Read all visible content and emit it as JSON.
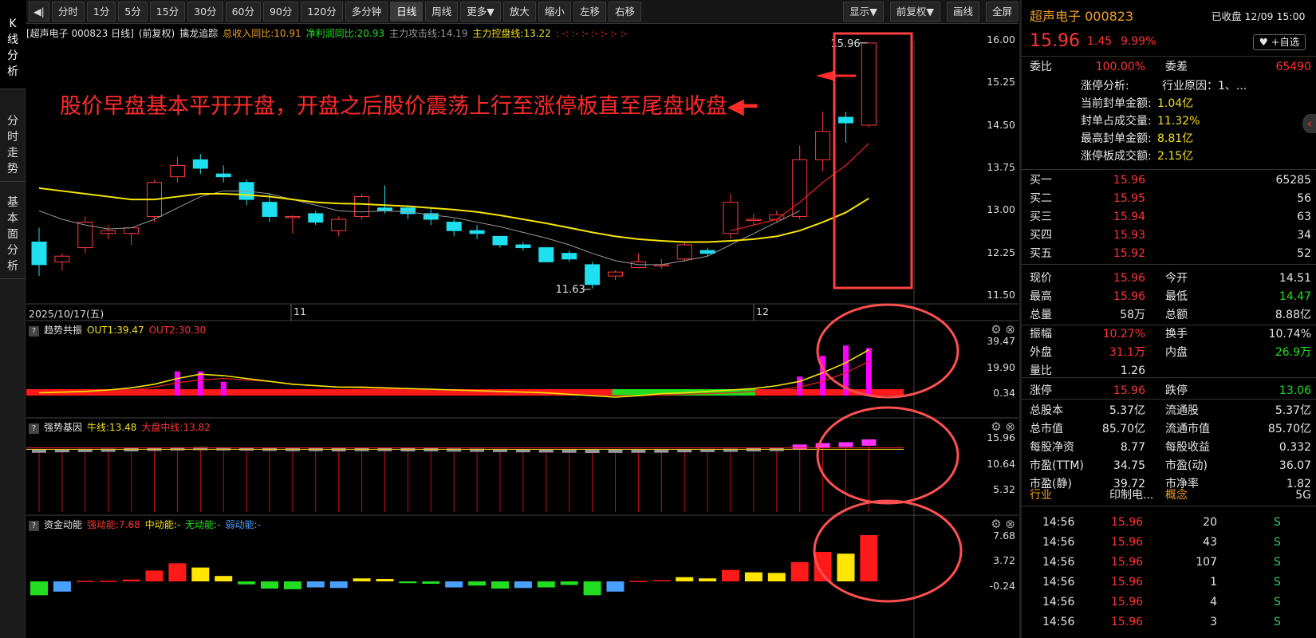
{
  "side_tabs": [
    "K线分析",
    "分时走势",
    "基本面分析"
  ],
  "toolbar": {
    "back_icon": "collapse-left-icon",
    "periods": [
      "分时",
      "1分",
      "5分",
      "15分",
      "30分",
      "60分",
      "90分",
      "120分",
      "多分钟",
      "日线",
      "周线",
      "更多▼"
    ],
    "active_period": "日线",
    "actions": [
      "放大",
      "缩小",
      "左移",
      "右移"
    ],
    "right_menus": [
      "显示▼",
      "前复权▼",
      "画线",
      "全屏"
    ]
  },
  "main_header": {
    "stock": "[超声电子 000823 日线]",
    "adjust": "(前复权)",
    "indicator": "擒龙追踪",
    "revenue": "总收入同比:10.91",
    "profit": "净利润同比:20.93",
    "attack": "主力攻击线:14.19",
    "control": "主力控盘线:13.22",
    "dots": ": -: :- :- :- :- :- :-"
  },
  "annotation": "股价早盘基本平开开盘，开盘之后股价震荡上行至涨停板直至尾盘收盘◀━",
  "price_axis": [
    "16.00",
    "15.25",
    "14.50",
    "13.75",
    "13.00",
    "12.25",
    "11.50"
  ],
  "price_labels": {
    "high": "15.96",
    "low": "11.63"
  },
  "date_axis": [
    "2025/10/17(五)",
    "11",
    "12"
  ],
  "pane1": {
    "name": "趋势共振",
    "out1": "OUT1:39.47",
    "out2": "OUT2:30.30",
    "axis": [
      "39.47",
      "19.90",
      "0.34"
    ]
  },
  "pane2": {
    "name": "强势基因",
    "niu": "牛线:13.48",
    "dapan": "大盘中线:13.82",
    "axis": [
      "15.96",
      "10.64",
      "5.32"
    ]
  },
  "pane3": {
    "name": "资金动能",
    "strong": "强动能:7.68",
    "mid": "中动能:-",
    "none": "无动能:-",
    "weak": "弱动能:-",
    "axis": [
      "7.68",
      "3.72",
      "-0.24"
    ]
  },
  "chart_data": {
    "type": "candlestick",
    "ylim": [
      11.5,
      16.0
    ],
    "candles": [
      [
        12.45,
        12.7,
        11.85,
        12.05
      ],
      [
        12.1,
        12.25,
        11.95,
        12.2
      ],
      [
        12.35,
        12.9,
        12.25,
        12.8
      ],
      [
        12.6,
        12.75,
        12.5,
        12.65
      ],
      [
        12.6,
        12.7,
        12.4,
        12.7
      ],
      [
        12.9,
        13.55,
        12.8,
        13.5
      ],
      [
        13.6,
        13.95,
        13.5,
        13.8
      ],
      [
        13.9,
        14.0,
        13.65,
        13.75
      ],
      [
        13.65,
        13.8,
        13.5,
        13.6
      ],
      [
        13.5,
        13.55,
        13.1,
        13.2
      ],
      [
        13.15,
        13.3,
        12.8,
        12.9
      ],
      [
        12.9,
        12.92,
        12.6,
        12.9
      ],
      [
        12.95,
        13.0,
        12.75,
        12.8
      ],
      [
        12.65,
        12.9,
        12.55,
        12.85
      ],
      [
        12.9,
        13.3,
        12.85,
        13.25
      ],
      [
        13.05,
        13.45,
        12.95,
        13.0
      ],
      [
        13.05,
        13.1,
        12.85,
        12.95
      ],
      [
        12.95,
        13.05,
        12.75,
        12.85
      ],
      [
        12.8,
        12.85,
        12.55,
        12.65
      ],
      [
        12.65,
        12.75,
        12.5,
        12.6
      ],
      [
        12.55,
        12.55,
        12.35,
        12.4
      ],
      [
        12.4,
        12.45,
        12.3,
        12.35
      ],
      [
        12.35,
        12.35,
        12.1,
        12.1
      ],
      [
        12.25,
        12.3,
        12.1,
        12.15
      ],
      [
        12.05,
        12.1,
        11.63,
        11.7
      ],
      [
        11.85,
        11.95,
        11.78,
        11.92
      ],
      [
        12.0,
        12.25,
        11.98,
        12.1
      ],
      [
        12.05,
        12.15,
        11.98,
        12.05
      ],
      [
        12.15,
        12.45,
        12.1,
        12.4
      ],
      [
        12.3,
        12.35,
        12.2,
        12.25
      ],
      [
        12.6,
        13.3,
        12.5,
        13.15
      ],
      [
        12.85,
        12.95,
        12.75,
        12.85
      ],
      [
        12.85,
        13.0,
        12.8,
        12.93
      ],
      [
        12.9,
        14.15,
        12.85,
        13.9
      ],
      [
        13.9,
        14.75,
        13.7,
        14.4
      ],
      [
        14.65,
        14.75,
        14.2,
        14.55
      ],
      [
        14.51,
        15.96,
        14.47,
        15.96
      ]
    ],
    "ma_yellow": [
      13.4,
      13.35,
      13.3,
      13.25,
      13.2,
      13.2,
      13.25,
      13.3,
      13.3,
      13.28,
      13.25,
      13.2,
      13.15,
      13.13,
      13.12,
      13.1,
      13.08,
      13.05,
      13.02,
      12.98,
      12.92,
      12.85,
      12.78,
      12.7,
      12.62,
      12.55,
      12.5,
      12.47,
      12.45,
      12.45,
      12.47,
      12.5,
      12.55,
      12.65,
      12.8,
      12.97,
      13.22
    ],
    "ma_gray": [
      13.0,
      12.85,
      12.75,
      12.68,
      12.7,
      12.85,
      13.05,
      13.25,
      13.35,
      13.35,
      13.3,
      13.2,
      13.1,
      13.0,
      12.98,
      13.0,
      12.98,
      12.93,
      12.88,
      12.8,
      12.72,
      12.62,
      12.52,
      12.4,
      12.25,
      12.12,
      12.05,
      12.05,
      12.12,
      12.2,
      12.4,
      12.6,
      12.8,
      13.0,
      null,
      null,
      null
    ],
    "ma_red": [
      null,
      null,
      null,
      null,
      null,
      null,
      null,
      null,
      null,
      null,
      null,
      null,
      null,
      null,
      null,
      null,
      null,
      null,
      null,
      null,
      null,
      null,
      null,
      null,
      null,
      null,
      null,
      null,
      null,
      null,
      12.65,
      12.75,
      12.85,
      13.15,
      13.5,
      13.8,
      14.19
    ],
    "pane1_bars": [
      0,
      0,
      0,
      0,
      0,
      0,
      0.5,
      0.5,
      0.3,
      0,
      0,
      0,
      0,
      0,
      0,
      0,
      0,
      0,
      0,
      0,
      0,
      0,
      0,
      0,
      0,
      0,
      0,
      0,
      0,
      0,
      0,
      0,
      0,
      0.4,
      0.8,
      1.0,
      0.95
    ],
    "pane1_strip_green": [
      25,
      31
    ],
    "pane2_levels": [
      13.0,
      13.1,
      13.15,
      13.2,
      13.3,
      13.4,
      13.5,
      13.55,
      13.5,
      13.45,
      13.4,
      13.35,
      13.35,
      13.3,
      13.35,
      13.35,
      13.3,
      13.3,
      13.25,
      13.2,
      13.15,
      13.1,
      13.05,
      13.0,
      12.95,
      12.98,
      13.0,
      13.02,
      13.1,
      13.15,
      13.2,
      13.3,
      13.35,
      14.1,
      14.4,
      14.6,
      15.2
    ],
    "pane3_values": [
      -2.3,
      -1.7,
      0.1,
      0.1,
      0.3,
      1.8,
      3.0,
      2.3,
      0.9,
      -0.5,
      -1.2,
      -1.3,
      -1.0,
      -1.1,
      0.5,
      0.4,
      -0.3,
      -0.4,
      -1.0,
      -0.7,
      -1.2,
      -1.1,
      -1.0,
      -0.6,
      -2.3,
      -1.7,
      0.1,
      0.2,
      0.7,
      0.5,
      1.9,
      1.5,
      1.4,
      3.2,
      4.9,
      4.6,
      7.68
    ]
  },
  "quote": {
    "name": "超声电子 000823",
    "status": "已收盘 12/09 15:00",
    "price": "15.96",
    "change": "1.45",
    "pct": "9.99%",
    "fav": "+自选",
    "weibi_label": "委比",
    "weibi": "100.00%",
    "weicha_label": "委差",
    "weicha": "65490",
    "limit_up": [
      {
        "k": "涨停分析:",
        "v": "行业原因：1、..."
      },
      {
        "k": "当前封单金额:",
        "v": "1.04亿"
      },
      {
        "k": "封单占成交量:",
        "v": "11.32%"
      },
      {
        "k": "最高封单金额:",
        "v": "8.81亿"
      },
      {
        "k": "涨停板成交额:",
        "v": "2.15亿"
      }
    ],
    "buys": [
      {
        "label": "买一",
        "price": "15.96",
        "vol": "65285"
      },
      {
        "label": "买二",
        "price": "15.95",
        "vol": "56"
      },
      {
        "label": "买三",
        "price": "15.94",
        "vol": "63"
      },
      {
        "label": "买四",
        "price": "15.93",
        "vol": "34"
      },
      {
        "label": "买五",
        "price": "15.92",
        "vol": "52"
      }
    ],
    "stats": [
      [
        {
          "k": "现价",
          "v": "15.96",
          "c": "red"
        },
        {
          "k": "今开",
          "v": "14.51",
          "c": "white"
        }
      ],
      [
        {
          "k": "最高",
          "v": "15.96",
          "c": "red"
        },
        {
          "k": "最低",
          "v": "14.47",
          "c": "green"
        }
      ],
      [
        {
          "k": "总量",
          "v": "58万",
          "c": "white"
        },
        {
          "k": "总额",
          "v": "8.88亿",
          "c": "white"
        }
      ],
      [
        {
          "k": "振幅",
          "v": "10.27%",
          "c": "red"
        },
        {
          "k": "换手",
          "v": "10.74%",
          "c": "white"
        }
      ],
      [
        {
          "k": "外盘",
          "v": "31.1万",
          "c": "red"
        },
        {
          "k": "内盘",
          "v": "26.9万",
          "c": "green"
        }
      ],
      [
        {
          "k": "量比",
          "v": "1.26",
          "c": "white"
        },
        {
          "k": "",
          "v": "",
          "c": "white"
        }
      ],
      [
        {
          "k": "涨停",
          "v": "15.96",
          "c": "red"
        },
        {
          "k": "跌停",
          "v": "13.06",
          "c": "green"
        }
      ],
      [
        {
          "k": "总股本",
          "v": "5.37亿",
          "c": "white"
        },
        {
          "k": "流通股",
          "v": "5.37亿",
          "c": "white"
        }
      ],
      [
        {
          "k": "总市值",
          "v": "85.70亿",
          "c": "white"
        },
        {
          "k": "流通市值",
          "v": "85.70亿",
          "c": "white"
        }
      ],
      [
        {
          "k": "每股净资",
          "v": "8.77",
          "c": "white"
        },
        {
          "k": "每股收益",
          "v": "0.332",
          "c": "white"
        }
      ],
      [
        {
          "k": "市盈(TTM)",
          "v": "34.75",
          "c": "white"
        },
        {
          "k": "市盈(动)",
          "v": "36.07",
          "c": "white"
        }
      ],
      [
        {
          "k": "市盈(静)",
          "v": "39.72",
          "c": "white"
        },
        {
          "k": "市净率",
          "v": "1.82",
          "c": "white"
        }
      ]
    ],
    "industry": {
      "k": "行业",
      "v": "印制电...",
      "k2": "概念",
      "v2": "5G"
    },
    "ticks": [
      {
        "t": "14:56",
        "p": "15.96",
        "v": "20",
        "s": "S"
      },
      {
        "t": "14:56",
        "p": "15.96",
        "v": "43",
        "s": "S"
      },
      {
        "t": "14:56",
        "p": "15.96",
        "v": "107",
        "s": "S"
      },
      {
        "t": "14:56",
        "p": "15.96",
        "v": "1",
        "s": "S"
      },
      {
        "t": "14:56",
        "p": "15.96",
        "v": "4",
        "s": "S"
      },
      {
        "t": "14:56",
        "p": "15.96",
        "v": "3",
        "s": "S"
      }
    ]
  }
}
